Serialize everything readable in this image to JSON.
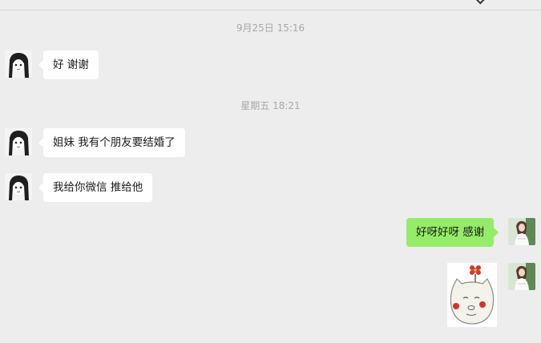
{
  "chat": {
    "colors": {
      "background": "#ededed",
      "incoming_bubble": "#ffffff",
      "outgoing_bubble": "#95ec69",
      "timestamp_text": "#a8a8a8"
    },
    "timestamps": [
      "9月25日 15:16",
      "星期五 18:21"
    ],
    "messages": [
      {
        "side": "left",
        "avatar": "anime-girl-avatar",
        "text": "好 谢谢"
      },
      {
        "side": "left",
        "avatar": "anime-girl-avatar",
        "text": "姐妹 我有个朋友要结婚了"
      },
      {
        "side": "left",
        "avatar": "anime-girl-avatar",
        "text": "我给你微信 推给他"
      },
      {
        "side": "right",
        "avatar": "girl-photo-avatar",
        "text": "好呀好呀 感谢"
      },
      {
        "side": "right",
        "avatar": "girl-photo-avatar",
        "sticker": "pig-face-with-flower-sticker"
      }
    ]
  }
}
